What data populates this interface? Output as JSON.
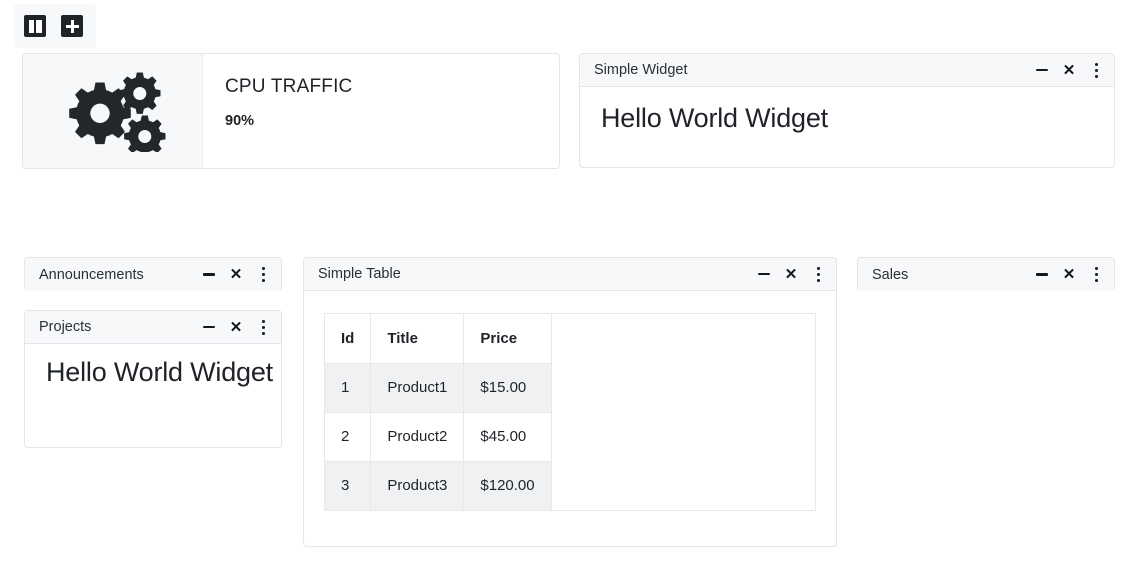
{
  "toolbar": {
    "buttons": [
      {
        "name": "columns-layout",
        "icon": "columns-icon",
        "label": ""
      },
      {
        "name": "add-widget",
        "icon": "plus-icon",
        "label": ""
      }
    ]
  },
  "panel_actions": {
    "minimize_label": "−",
    "close_label": "✕",
    "menu_label": "⋮"
  },
  "cpu_card": {
    "icon": "gears-icon",
    "title": "CPU TRAFFIC",
    "value": "90%"
  },
  "simple_widget": {
    "title": "Simple Widget",
    "body_text": "Hello World Widget"
  },
  "announcements": {
    "title": "Announcements"
  },
  "projects": {
    "title": "Projects",
    "body_text": "Hello World Widget"
  },
  "sales": {
    "title": "Sales"
  },
  "simple_table": {
    "title": "Simple Table",
    "columns": [
      "Id",
      "Title",
      "Price"
    ],
    "rows": [
      {
        "id": "1",
        "title": "Product1",
        "price": "$15.00"
      },
      {
        "id": "2",
        "title": "Product2",
        "price": "$45.00"
      },
      {
        "id": "3",
        "title": "Product3",
        "price": "$120.00"
      }
    ]
  },
  "colors": {
    "page_background": "#ffffff",
    "panel_header_background": "#f7f8f9",
    "panel_border": "#e3e5e8",
    "text_primary": "#1f2328",
    "table_row_shaded": "#f0f1f2",
    "icon_dark": "#1f2328"
  }
}
